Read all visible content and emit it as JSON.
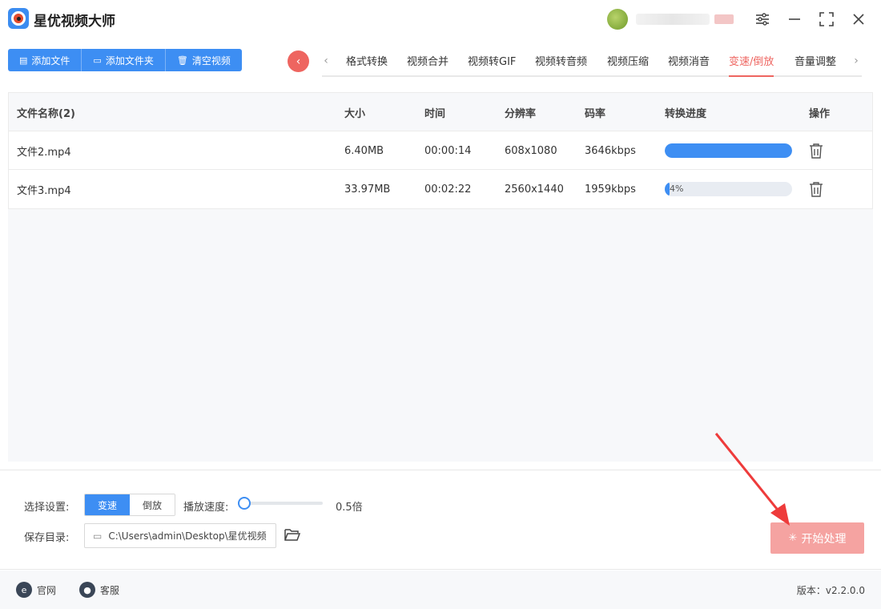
{
  "app": {
    "title": "星优视频大师"
  },
  "toolbar": {
    "add_file": "添加文件",
    "add_folder": "添加文件夹",
    "clear_videos": "清空视频"
  },
  "tabs": [
    {
      "label": "格式转换"
    },
    {
      "label": "视频合并"
    },
    {
      "label": "视频转GIF"
    },
    {
      "label": "视频转音频"
    },
    {
      "label": "视频压缩"
    },
    {
      "label": "视频消音"
    },
    {
      "label": "变速/倒放"
    },
    {
      "label": "音量调整"
    }
  ],
  "active_tab": "变速/倒放",
  "table": {
    "headers": {
      "name": "文件名称(2)",
      "size": "大小",
      "time": "时间",
      "resolution": "分辨率",
      "bitrate": "码率",
      "progress": "转换进度",
      "action": "操作"
    },
    "rows": [
      {
        "name": "文件2.mp4",
        "size": "6.40MB",
        "time": "00:00:14",
        "resolution": "608x1080",
        "bitrate": "3646kbps",
        "progress": 1.0,
        "progress_label": ""
      },
      {
        "name": "文件3.mp4",
        "size": "33.97MB",
        "time": "00:02:22",
        "resolution": "2560x1440",
        "bitrate": "1959kbps",
        "progress": 0.04,
        "progress_label": "4%"
      }
    ]
  },
  "settings": {
    "mode_label": "选择设置:",
    "mode_speed": "变速",
    "mode_reverse": "倒放",
    "speed_label": "播放速度:",
    "speed_value": "0.5倍",
    "save_label": "保存目录:",
    "save_path": "C:\\Users\\admin\\Desktop\\星优视频",
    "start_button": "开始处理"
  },
  "footer": {
    "website": "官网",
    "support": "客服",
    "version": "版本：v2.2.0.0"
  },
  "colors": {
    "primary": "#3d8ef3",
    "accent": "#ee6560",
    "start_disabled": "#f5a3a1"
  }
}
